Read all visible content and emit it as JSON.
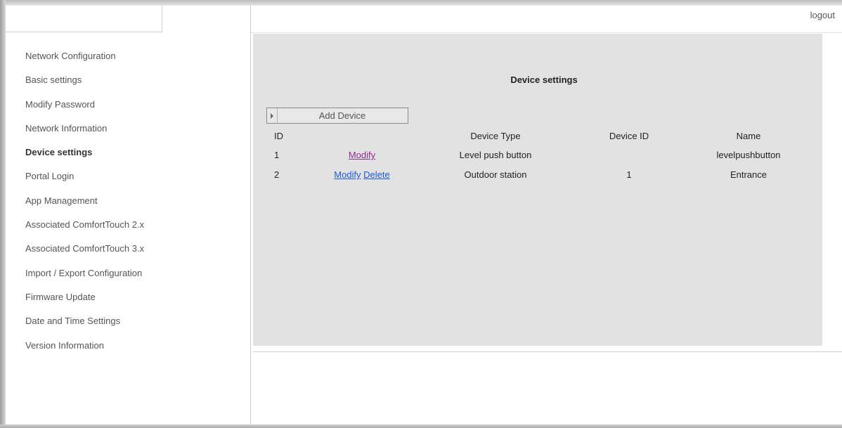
{
  "header": {
    "logout_label": "logout"
  },
  "sidebar": {
    "items": [
      {
        "label": "Network Configuration"
      },
      {
        "label": "Basic settings"
      },
      {
        "label": "Modify Password"
      },
      {
        "label": "Network Information"
      },
      {
        "label": "Device settings"
      },
      {
        "label": "Portal Login"
      },
      {
        "label": "App Management"
      },
      {
        "label": "Associated ComfortTouch 2.x"
      },
      {
        "label": "Associated ComfortTouch 3.x"
      },
      {
        "label": "Import / Export Configuration"
      },
      {
        "label": "Firmware Update"
      },
      {
        "label": "Date and Time Settings"
      },
      {
        "label": "Version Information"
      }
    ],
    "active_index": 4
  },
  "main": {
    "title": "Device settings",
    "add_device_label": "Add Device",
    "table": {
      "headers": {
        "id": "ID",
        "type": "Device Type",
        "device_id": "Device ID",
        "name": "Name"
      },
      "rows": [
        {
          "id": "1",
          "modify": "Modify",
          "delete": "",
          "type": "Level push button",
          "device_id": "",
          "name": "levelpushbutton"
        },
        {
          "id": "2",
          "modify": "Modify",
          "delete": "Delete",
          "type": "Outdoor station",
          "device_id": "1",
          "name": "Entrance"
        }
      ]
    }
  },
  "colors": {
    "panel_bg": "#e2e2e2",
    "link_visited": "#8e2b8e",
    "link": "#1a5bd6"
  },
  "icons": {
    "add_device_toggle": "triangle-right-icon"
  }
}
